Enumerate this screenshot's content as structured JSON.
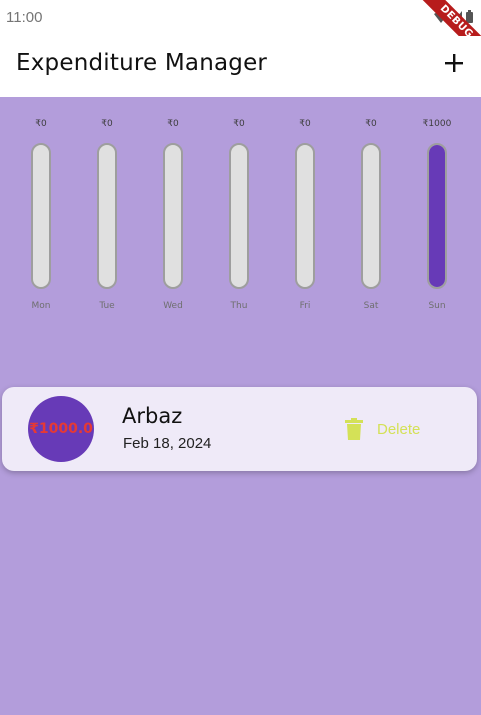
{
  "status_bar": {
    "time": "11:00",
    "debug_label": "DEBUG"
  },
  "app_bar": {
    "title": "Expenditure Manager",
    "add_icon": "plus-icon"
  },
  "chart_data": {
    "type": "bar",
    "categories": [
      "Mon",
      "Tue",
      "Wed",
      "Thu",
      "Fri",
      "Sat",
      "Sun"
    ],
    "value_labels": [
      "₹0",
      "₹0",
      "₹0",
      "₹0",
      "₹0",
      "₹0",
      "₹1000"
    ],
    "values": [
      0,
      0,
      0,
      0,
      0,
      0,
      1000
    ],
    "max": 1000,
    "colors": {
      "fill": "#673ab7",
      "track": "#e0e0e0",
      "track_border": "#9e9e9e"
    }
  },
  "transactions": [
    {
      "amount": "₹1000.0",
      "title": "Arbaz",
      "date": "Feb 18, 2024",
      "delete_label": "Delete",
      "delete_icon": "trash-icon"
    }
  ],
  "colors": {
    "background": "#b39ddb",
    "primary": "#673ab7",
    "card": "#efeaf8",
    "delete": "#d4e157",
    "amount_text": "#e53935"
  }
}
